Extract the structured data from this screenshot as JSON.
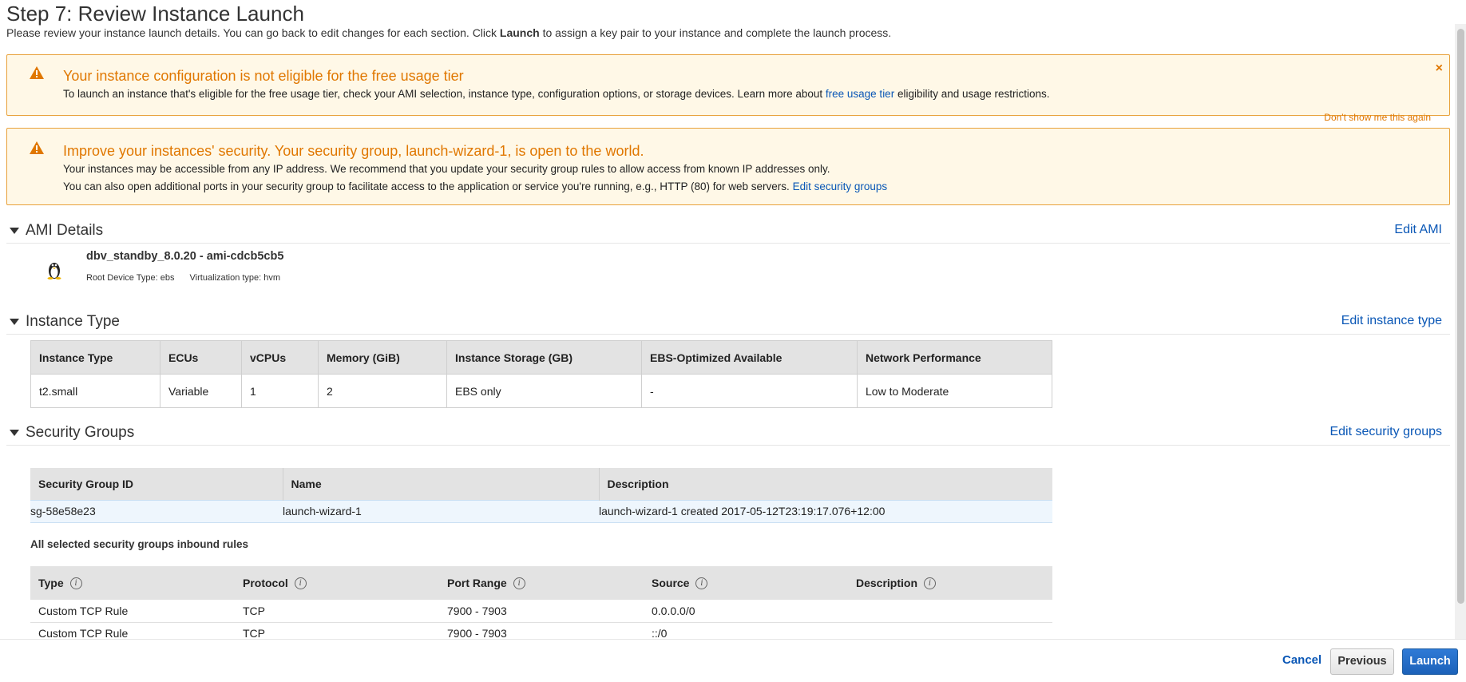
{
  "header": {
    "title": "Step 7: Review Instance Launch",
    "desc_pre": "Please review your instance launch details. You can go back to edit changes for each section. Click ",
    "desc_bold": "Launch",
    "desc_post": " to assign a key pair to your instance and complete the launch process."
  },
  "alert_free": {
    "title": "Your instance configuration is not eligible for the free usage tier",
    "line_pre": "To launch an instance that's eligible for the free usage tier, check your AMI selection, instance type, configuration options, or storage devices. Learn more about ",
    "line_link": "free usage tier",
    "line_post": " eligibility and usage restrictions.",
    "dismiss": "Don't show me this again",
    "close": "×"
  },
  "alert_sec": {
    "title": "Improve your instances' security. Your security group, launch-wizard-1, is open to the world.",
    "line1": "Your instances may be accessible from any IP address. We recommend that you update your security group rules to allow access from known IP addresses only.",
    "line2_pre": "You can also open additional ports in your security group to facilitate access to the application or service you're running, e.g., HTTP (80) for web servers. ",
    "line2_link": "Edit security groups"
  },
  "ami": {
    "section_title": "AMI Details",
    "edit": "Edit AMI",
    "name": "dbv_standby_8.0.20 - ami-cdcb5cb5",
    "root_device": "Root Device Type: ebs",
    "virtualization": "Virtualization type: hvm",
    "icon": "linux-tux-icon"
  },
  "instance_type": {
    "section_title": "Instance Type",
    "edit": "Edit instance type",
    "columns": [
      "Instance Type",
      "ECUs",
      "vCPUs",
      "Memory (GiB)",
      "Instance Storage (GB)",
      "EBS-Optimized Available",
      "Network Performance"
    ],
    "row": [
      "t2.small",
      "Variable",
      "1",
      "2",
      "EBS only",
      "-",
      "Low to Moderate"
    ]
  },
  "security_groups": {
    "section_title": "Security Groups",
    "edit": "Edit security groups",
    "columns": [
      "Security Group ID",
      "Name",
      "Description"
    ],
    "row": [
      "sg-58e58e23",
      "launch-wizard-1",
      "launch-wizard-1 created 2017-05-12T23:19:17.076+12:00"
    ],
    "inbound_label": "All selected security groups inbound rules",
    "rule_columns": [
      "Type",
      "Protocol",
      "Port Range",
      "Source",
      "Description"
    ],
    "rules": [
      [
        "Custom TCP Rule",
        "TCP",
        "7900 - 7903",
        "0.0.0.0/0",
        ""
      ],
      [
        "Custom TCP Rule",
        "TCP",
        "7900 - 7903",
        "::/0",
        ""
      ]
    ]
  },
  "footer": {
    "cancel": "Cancel",
    "previous": "Previous",
    "launch": "Launch"
  },
  "colors": {
    "warning": "#e07700",
    "link": "#0a57b6",
    "primary_button": "#1c62b9"
  }
}
